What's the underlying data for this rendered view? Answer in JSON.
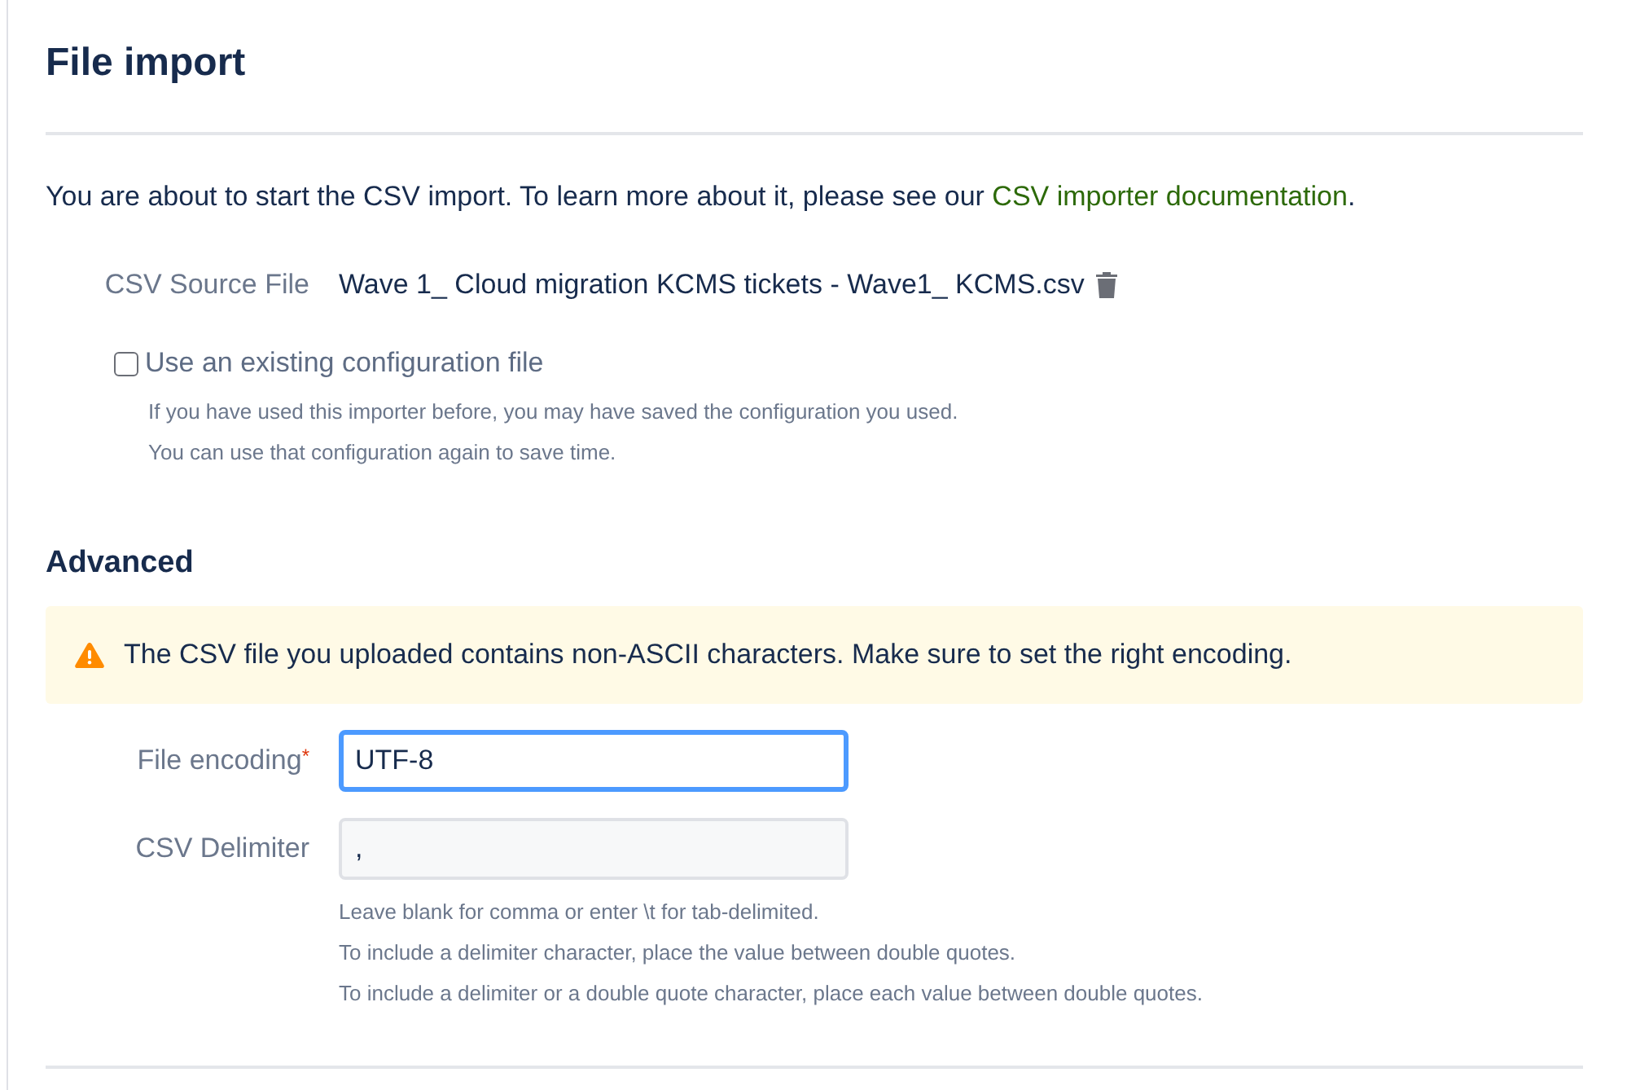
{
  "title": "File import",
  "intro": {
    "text": "You are about to start the CSV import. To learn more about it, please see our ",
    "link": "CSV importer documentation",
    "end": "."
  },
  "source_file": {
    "label": "CSV Source File",
    "value": "Wave 1_ Cloud migration KCMS tickets - Wave1_ KCMS.csv"
  },
  "config_option": {
    "label": "Use an existing configuration file",
    "checked": false,
    "help": [
      "If you have used this importer before, you may have saved the configuration you used.",
      "You can use that configuration again to save time."
    ]
  },
  "advanced": {
    "heading": "Advanced",
    "warning": "The CSV file you uploaded contains non-ASCII characters. Make sure to set the right encoding.",
    "fields": [
      {
        "label": "File encoding",
        "required_mark": "*",
        "value": "UTF-8",
        "focused": true
      },
      {
        "label": "CSV Delimiter",
        "value": ",",
        "focused": false,
        "help": [
          "Leave blank for comma or enter \\t for tab-delimited.",
          "To include a delimiter character, place the value between double quotes.",
          "To include a delimiter or a double quote character, place each value between double quotes."
        ]
      }
    ]
  }
}
